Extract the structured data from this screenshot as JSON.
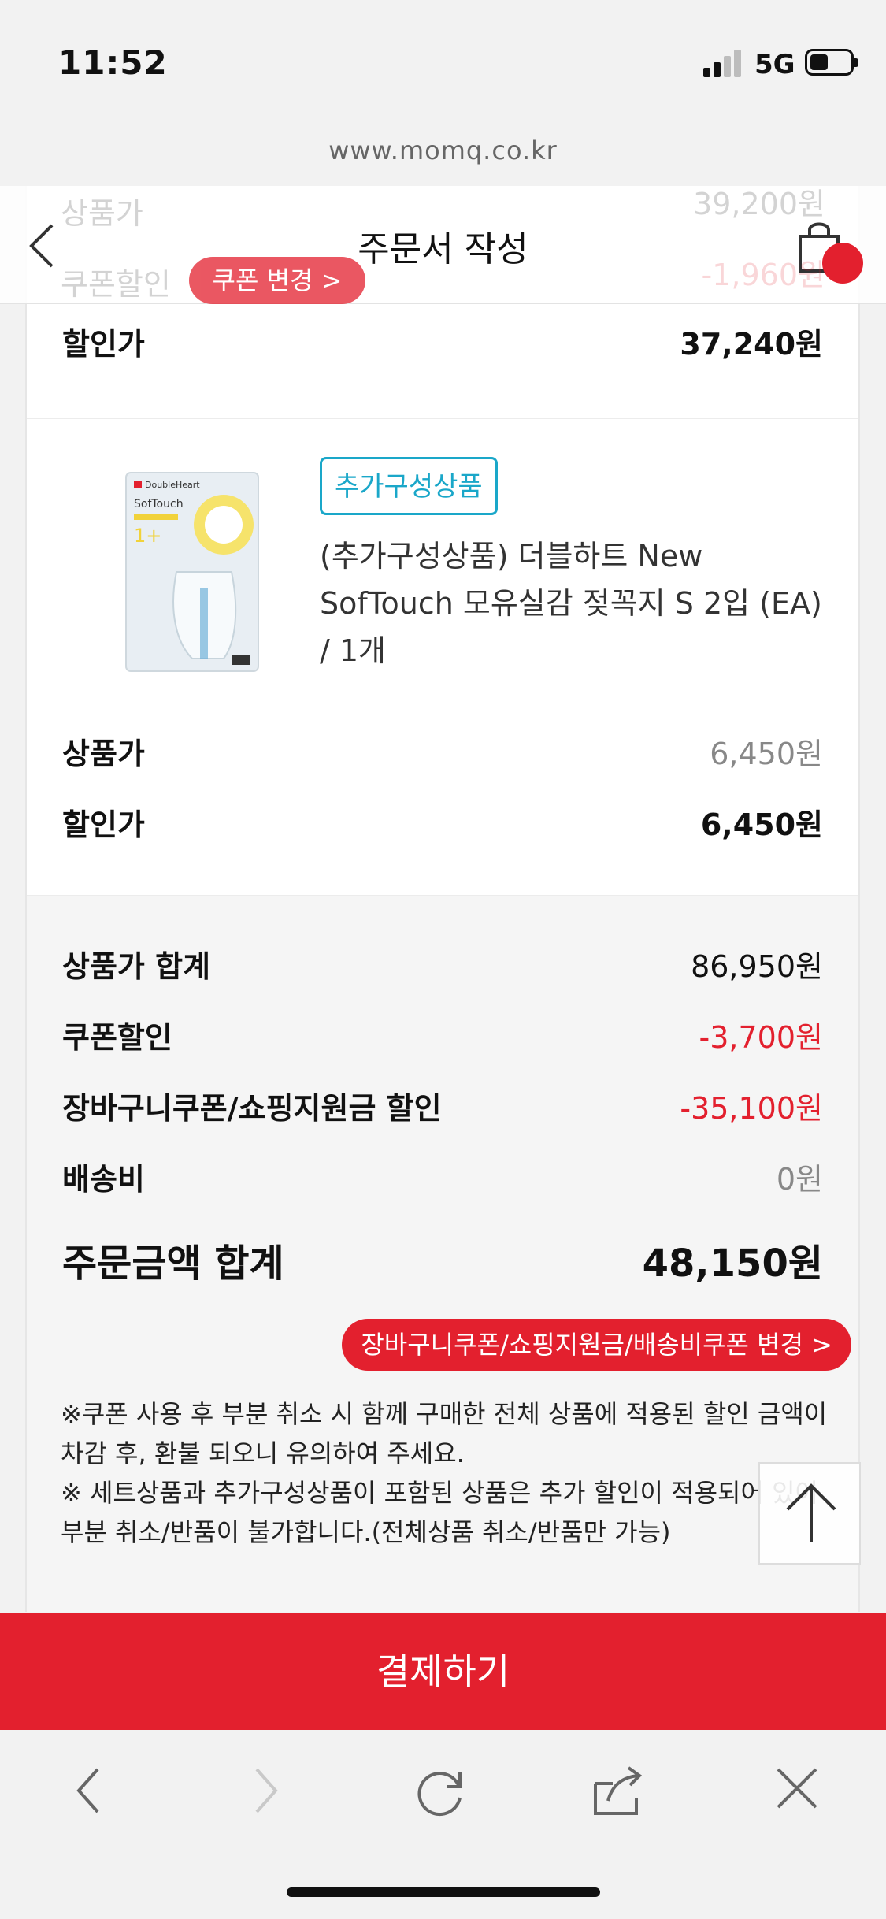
{
  "status_bar": {
    "time": "11:52",
    "network": "5G",
    "url": "www.momq.co.kr"
  },
  "header": {
    "title": "주문서 작성"
  },
  "ghost_rows": {
    "price_label": "상품가",
    "price_value": "39,200원",
    "coupon_label": "쿠폰할인",
    "coupon_value": "-1,960원",
    "coupon_change": "쿠폰 변경 >"
  },
  "item1": {
    "discount_label": "할인가",
    "discount_value": "37,240원"
  },
  "item2": {
    "tag": "추가구성상품",
    "name": "(추가구성상품) 더블하트 New SofTouch 모유실감 젖꼭지 S 2입 (EA) / 1개",
    "price_label": "상품가",
    "price_value": "6,450원",
    "discount_label": "할인가",
    "discount_value": "6,450원"
  },
  "summary": {
    "subtotal_label": "상품가 합계",
    "subtotal_value": "86,950원",
    "coupon_label": "쿠폰할인",
    "coupon_value": "-3,700원",
    "cart_coupon_label": "장바구니쿠폰/쇼핑지원금 할인",
    "cart_coupon_value": "-35,100원",
    "shipping_label": "배송비",
    "shipping_value": "0원",
    "total_label": "주문금액 합계",
    "total_value": "48,150원",
    "change_button": "장바구니쿠폰/쇼핑지원금/배송비쿠폰 변경  >"
  },
  "notice": {
    "line1": "※쿠폰 사용 후 부분 취소 시 함께 구매한 전체 상품에 적용된 할인 금액이 차감 후, 환불 되오니 유의하여 주세요.",
    "line2": "※ 세트상품과 추가구성상품이 포함된 상품은 추가 할인이 적용되어 있어 부분 취소/반품이 불가합니다.(전체상품 취소/반품만 가능)"
  },
  "pay_button": "결제하기",
  "colors": {
    "accent": "#e3202e",
    "tag": "#1aa7c9"
  }
}
